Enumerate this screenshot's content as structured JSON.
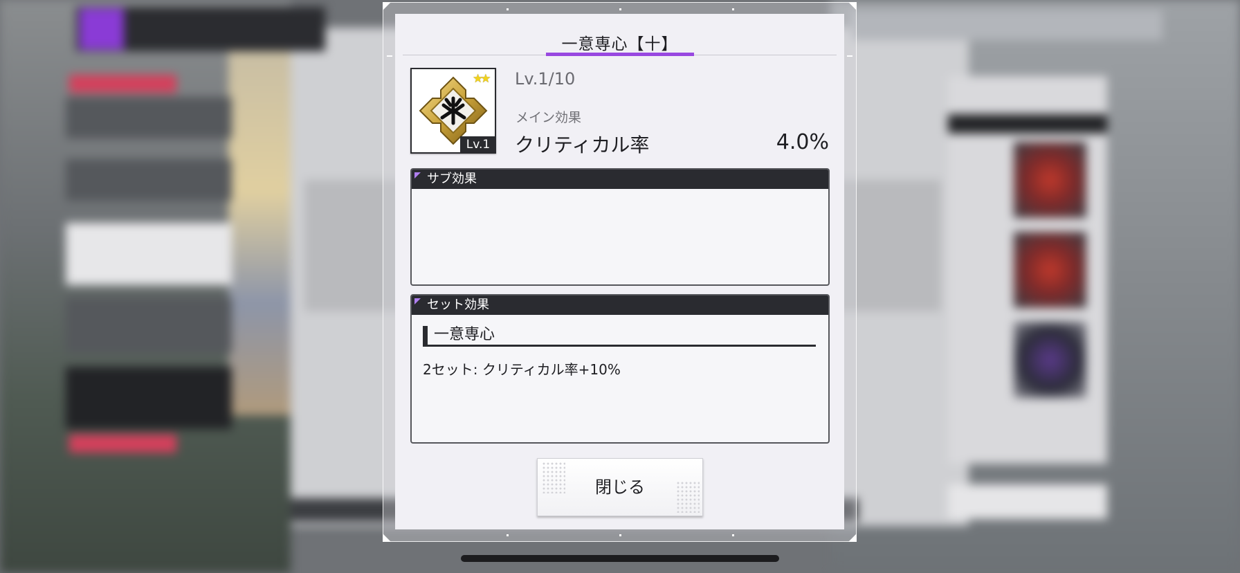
{
  "modal": {
    "title": "一意専心【十】",
    "item": {
      "level_badge": "Lv.1",
      "stars": "★★",
      "level_text": "Lv.1/10",
      "main_label": "メイン効果",
      "main_stat": "クリティカル率",
      "main_value": "4.0%"
    },
    "sub_effect": {
      "header": "サブ効果"
    },
    "set_effect": {
      "header": "セット効果",
      "set_name": "一意専心",
      "description": "2セット: クリティカル率+10%"
    },
    "close_label": "閉じる"
  },
  "colors": {
    "accent": "#9848e0",
    "header_bg": "#2a2b30",
    "modal_bg": "#f1f0f5",
    "star": "#f2d21c",
    "emblem_gold": "#c9a23a"
  },
  "icons": [
    "sigil-emblem-icon",
    "star-icon"
  ]
}
